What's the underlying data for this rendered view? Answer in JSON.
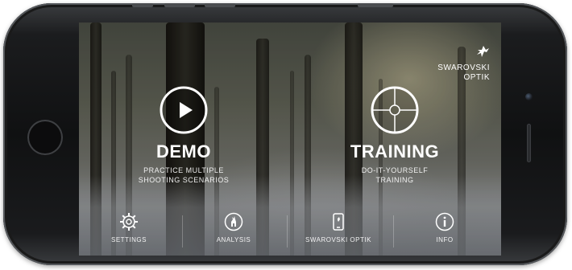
{
  "brand": {
    "line1": "SWAROVSKI",
    "line2": "OPTIK",
    "logo_icon": "hawk-logo-icon"
  },
  "actions": [
    {
      "id": "demo",
      "icon": "play-icon",
      "title": "DEMO",
      "subtitle_line1": "PRACTICE MULTIPLE",
      "subtitle_line2": "SHOOTING SCENARIOS"
    },
    {
      "id": "training",
      "icon": "crosshair-icon",
      "title": "TRAINING",
      "subtitle_line1": "DO-IT-YOURSELF",
      "subtitle_line2": "TRAINING"
    }
  ],
  "nav": [
    {
      "id": "settings",
      "icon": "gear-icon",
      "label": "SETTINGS"
    },
    {
      "id": "analysis",
      "icon": "animal-icon",
      "label": "ANALYSIS"
    },
    {
      "id": "swarovski-optik",
      "icon": "phone-icon",
      "label": "SWAROVSKI OPTIK"
    },
    {
      "id": "info",
      "icon": "info-icon",
      "label": "INFO"
    }
  ],
  "colors": {
    "text": "#ffffff",
    "phone_body": "#101112",
    "screen_bg": "#5e6054"
  }
}
